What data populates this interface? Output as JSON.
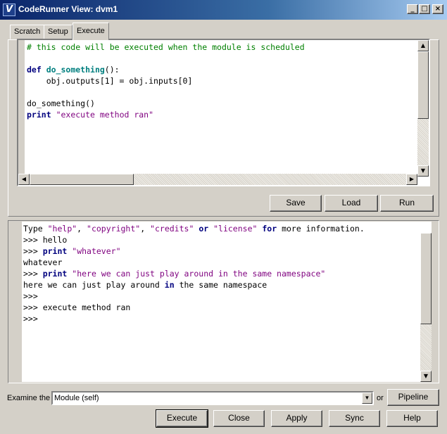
{
  "window": {
    "title": "CodeRunner View: dvm1",
    "app_icon_letter": "V",
    "minimize_glyph": "_",
    "maximize_glyph": "□",
    "close_glyph": "×",
    "titlebar_color": "#0a246a"
  },
  "tabs": [
    {
      "label": "Scratch",
      "active": false
    },
    {
      "label": "Setup",
      "active": false
    },
    {
      "label": "Execute",
      "active": true
    }
  ],
  "editor": {
    "lines": [
      {
        "tokens": [
          {
            "t": "# this code will be executed when the module is scheduled",
            "c": "cm"
          }
        ]
      },
      {
        "tokens": []
      },
      {
        "tokens": [
          {
            "t": "def ",
            "c": "kw"
          },
          {
            "t": "do_something",
            "c": "fn"
          },
          {
            "t": "():",
            "c": ""
          }
        ]
      },
      {
        "tokens": [
          {
            "t": "    obj.outputs[1] = obj.inputs[0]",
            "c": ""
          }
        ]
      },
      {
        "tokens": []
      },
      {
        "tokens": [
          {
            "t": "do_something()",
            "c": ""
          }
        ]
      },
      {
        "tokens": [
          {
            "t": "print",
            "c": "kw"
          },
          {
            "t": " ",
            "c": ""
          },
          {
            "t": "\"execute method ran\"",
            "c": "str"
          }
        ]
      }
    ]
  },
  "editor_buttons": {
    "save": "Save",
    "load": "Load",
    "run": "Run"
  },
  "console": {
    "lines": [
      {
        "tokens": [
          {
            "t": "Type ",
            "c": ""
          },
          {
            "t": "\"help\"",
            "c": "str"
          },
          {
            "t": ", ",
            "c": ""
          },
          {
            "t": "\"copyright\"",
            "c": "str"
          },
          {
            "t": ", ",
            "c": ""
          },
          {
            "t": "\"credits\"",
            "c": "str"
          },
          {
            "t": " ",
            "c": ""
          },
          {
            "t": "or",
            "c": "kw"
          },
          {
            "t": " ",
            "c": ""
          },
          {
            "t": "\"license\"",
            "c": "str"
          },
          {
            "t": " ",
            "c": ""
          },
          {
            "t": "for",
            "c": "kw"
          },
          {
            "t": " more information.",
            "c": ""
          }
        ]
      },
      {
        "tokens": [
          {
            "t": ">>> hello",
            "c": ""
          }
        ]
      },
      {
        "tokens": [
          {
            "t": ">>> ",
            "c": ""
          },
          {
            "t": "print",
            "c": "kw"
          },
          {
            "t": " ",
            "c": ""
          },
          {
            "t": "\"whatever\"",
            "c": "str"
          }
        ]
      },
      {
        "tokens": [
          {
            "t": "whatever",
            "c": ""
          }
        ]
      },
      {
        "tokens": [
          {
            "t": ">>> ",
            "c": ""
          },
          {
            "t": "print",
            "c": "kw"
          },
          {
            "t": " ",
            "c": ""
          },
          {
            "t": "\"here we can just play around in the same namespace\"",
            "c": "str"
          }
        ]
      },
      {
        "tokens": [
          {
            "t": "here we can just play around ",
            "c": ""
          },
          {
            "t": "in",
            "c": "kw"
          },
          {
            "t": " the same namespace",
            "c": ""
          }
        ]
      },
      {
        "tokens": [
          {
            "t": ">>>",
            "c": ""
          }
        ]
      },
      {
        "tokens": [
          {
            "t": ">>> execute method ran",
            "c": ""
          }
        ]
      },
      {
        "tokens": [
          {
            "t": ">>>",
            "c": ""
          }
        ]
      }
    ]
  },
  "examine": {
    "label": "Examine the",
    "selected": "Module (self)",
    "or_label": "or",
    "pipeline_button": "Pipeline"
  },
  "footer_buttons": {
    "execute": "Execute",
    "close": "Close",
    "apply": "Apply",
    "sync": "Sync",
    "help": "Help"
  },
  "scroll_glyphs": {
    "up": "▲",
    "down": "▼",
    "left": "◀",
    "right": "▶",
    "dropdown": "▼"
  }
}
